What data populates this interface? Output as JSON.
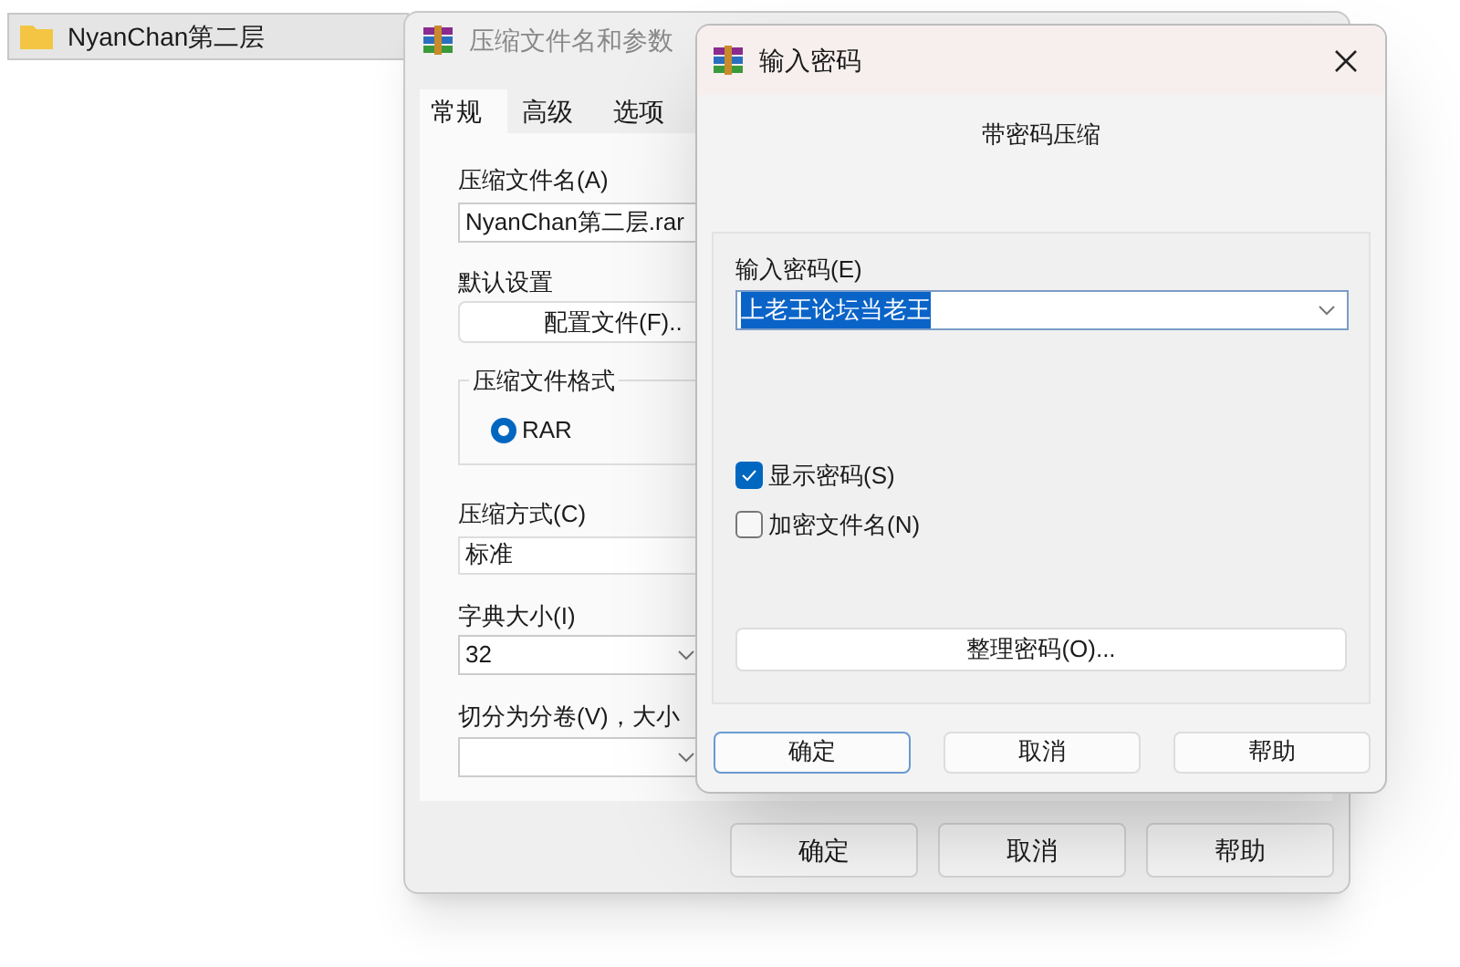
{
  "explorer": {
    "folder": "NyanChan第二层"
  },
  "archive_dialog": {
    "title": "压缩文件名和参数",
    "tabs": [
      {
        "label": "常规",
        "selected": true
      },
      {
        "label": "高级",
        "selected": false
      },
      {
        "label": "选项",
        "selected": false
      }
    ],
    "archive_name": {
      "label": "压缩文件名(A)",
      "value": "NyanChan第二层.rar"
    },
    "profiles": {
      "label": "默认设置",
      "button": "配置文件(F).."
    },
    "format": {
      "legend": "压缩文件格式",
      "options": [
        {
          "label": "RAR",
          "selected": true
        }
      ]
    },
    "method": {
      "label": "压缩方式(C)",
      "value": "标准"
    },
    "dictionary": {
      "label": "字典大小(I)",
      "value": "32"
    },
    "split": {
      "label": "切分为分卷(V)，大小"
    },
    "buttons": [
      "确定",
      "取消",
      "帮助"
    ]
  },
  "password_dialog": {
    "title": "输入密码",
    "subtitle": "带密码压缩",
    "password": {
      "label": "输入密码(E)",
      "value": "上老王论坛当老王"
    },
    "options": [
      {
        "label": "显示密码(S)",
        "checked": true
      },
      {
        "label": "加密文件名(N)",
        "checked": false
      }
    ],
    "organize_button": "整理密码(O)...",
    "buttons": [
      {
        "label": "确定",
        "default": true
      },
      {
        "label": "取消",
        "default": false
      },
      {
        "label": "帮助",
        "default": false
      }
    ]
  }
}
